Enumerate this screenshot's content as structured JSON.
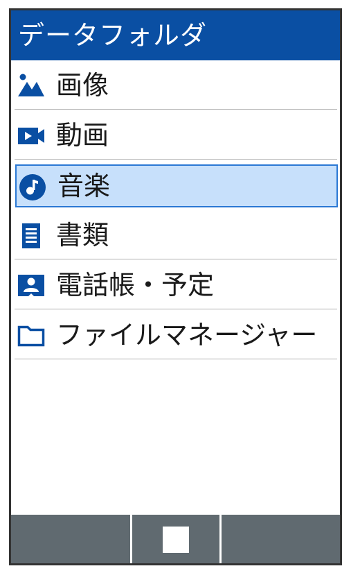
{
  "header": {
    "title": "データフォルダ",
    "color": "#0a4fa3"
  },
  "menu": {
    "items": [
      {
        "label": "画像",
        "icon": "image-icon",
        "selected": false
      },
      {
        "label": "動画",
        "icon": "video-icon",
        "selected": false
      },
      {
        "label": "音楽",
        "icon": "music-icon",
        "selected": true
      },
      {
        "label": "書類",
        "icon": "document-icon",
        "selected": false
      },
      {
        "label": "電話帳・予定",
        "icon": "contacts-book-icon",
        "selected": false
      },
      {
        "label": "ファイルマネージャー",
        "icon": "folder-icon",
        "selected": false
      }
    ]
  },
  "softkeys": {
    "center_icon": "square-icon",
    "background": "#606a70"
  },
  "colors": {
    "accent": "#0a4fa3",
    "selection_fill": "#c7e0fb",
    "selection_border": "#2a78d4"
  }
}
